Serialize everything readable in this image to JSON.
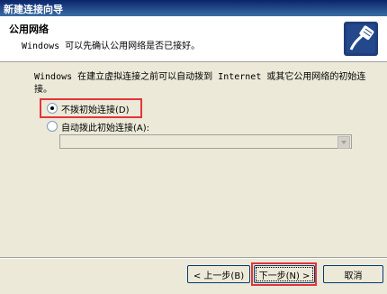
{
  "window": {
    "title": "新建连接向导"
  },
  "header": {
    "title": "公用网络",
    "subtitle": "Windows 可以先确认公用网络是否已接好。",
    "logo_icon": "network-cable-icon"
  },
  "main": {
    "description": "Windows 在建立虚拟连接之前可以自动拨到 Internet 或其它公用网络的初始连接。",
    "options": [
      {
        "label": "不拨初始连接(D)",
        "checked": true
      },
      {
        "label": "自动拨此初始连接(A):",
        "checked": false
      }
    ],
    "dial_combo": {
      "value": ""
    }
  },
  "buttons": {
    "back": "< 上一步(B)",
    "next": "下一步(N) >",
    "cancel": "取消"
  }
}
